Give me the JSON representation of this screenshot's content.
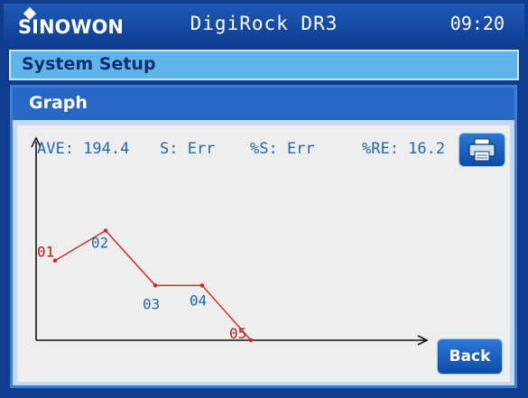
{
  "header": {
    "brand": "SINOWON",
    "title": "DigiRock DR3",
    "time": "09:20"
  },
  "setup_bar": {
    "label": "System Setup"
  },
  "graph_panel": {
    "title": "Graph",
    "stats": {
      "ave": "AVE: 194.4",
      "s": "S: Err",
      "pct_s": "%S: Err",
      "pct_re": "%RE: 16.2"
    },
    "print_button": {
      "icon": "printer-icon"
    },
    "back_button": {
      "label": "Back"
    }
  },
  "colors": {
    "accent": "#2768c7",
    "line": "#d92020",
    "label_red": "#c01818",
    "label_blue": "#1d68b7"
  },
  "chart_data": {
    "type": "line",
    "x": [
      "01",
      "02",
      "03",
      "04",
      "05"
    ],
    "values": [
      3.2,
      4.4,
      2.2,
      2.2,
      0
    ],
    "label_colors": [
      "#c01818",
      "#1d68b7",
      "#1d68b7",
      "#1d68b7",
      "#c01818"
    ],
    "grid": false
  }
}
